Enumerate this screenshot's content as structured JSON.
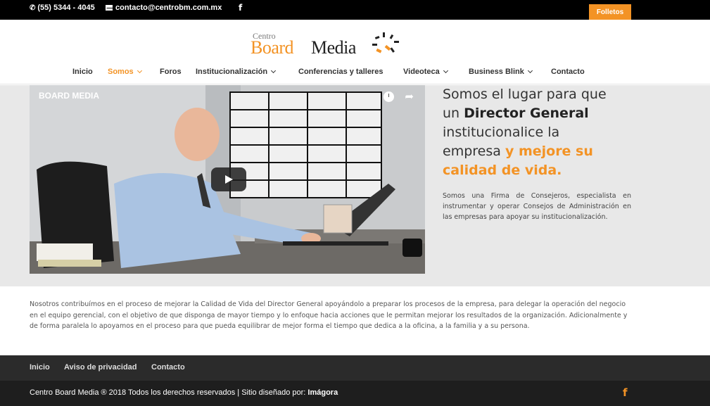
{
  "topbar": {
    "phone": "(55) 5344 - 4045",
    "email": "contacto@centrobm.com.mx",
    "facebook_icon": "facebook-icon",
    "cta_label": "Folletos"
  },
  "logo": {
    "small": "Centro",
    "board": "Board",
    "media": "Media"
  },
  "nav": {
    "items": [
      {
        "label": "Inicio"
      },
      {
        "label": "Somos"
      },
      {
        "label": "Foros"
      },
      {
        "label": "Institucionalización"
      },
      {
        "label": "Conferencias y talleres"
      },
      {
        "label": "Videoteca"
      },
      {
        "label": "Business Blink"
      },
      {
        "label": "Contacto"
      }
    ]
  },
  "video": {
    "title": "BOARD MEDIA",
    "icons": [
      "clock-icon",
      "share-icon",
      "play-icon"
    ]
  },
  "hero": {
    "line1": "Somos el lugar para que",
    "line2_prefix": "un ",
    "line2_strong": "Director General",
    "line3": "institucionalice la",
    "line4_prefix": "empresa ",
    "line4_orange": "y mejore su",
    "line5_orange": "calidad de vida.",
    "description": "Somos una Firma de Consejeros, especialista en instrumentar y operar Consejos de Administración en las empresas para apoyar su institucionalización."
  },
  "about": {
    "text": "Nosotros contribuímos en el proceso de mejorar la Calidad de Vida del Director General apoyándolo a preparar los procesos de la empresa, para delegar la operación del negocio en el equipo gerencial, con el objetivo de que disponga de mayor tiempo y lo enfoque hacia acciones que le permitan mejorar los resultados de la organización. Adicionalmente y de forma paralela lo apoyamos en el proceso para que pueda equilibrar de mejor forma el tiempo que dedica a la oficina, a la familia y a su persona."
  },
  "footer": {
    "links": [
      {
        "label": "Inicio"
      },
      {
        "label": "Aviso de privacidad"
      },
      {
        "label": "Contacto"
      }
    ],
    "copyright_prefix": "Centro Board Media ® 2018 Todos los derechos reservados | Sitio diseñado por: ",
    "designer": "Imágora",
    "facebook_icon": "facebook-icon"
  },
  "colors": {
    "accent": "#f39325",
    "topbar": "#000000",
    "footer_nav": "#2b2b2b",
    "footer_bottom": "#1e1e1e"
  }
}
